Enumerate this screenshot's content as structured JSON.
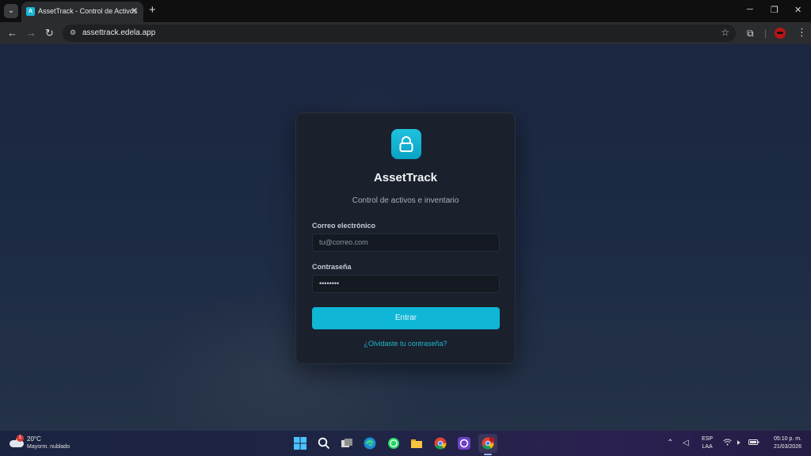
{
  "browser": {
    "tab_title": "AssetTrack - Control de Activos",
    "tab_favicon_letter": "A",
    "url": "assettrack.edela.app"
  },
  "login": {
    "app_name": "AssetTrack",
    "subtitle": "Control de activos e inventario",
    "email_label": "Correo electrónico",
    "email_placeholder": "tu@correo.com",
    "password_label": "Contraseña",
    "password_value": "••••••••",
    "submit_label": "Entrar",
    "forgot_link": "¿Olvidaste tu contraseña?",
    "accent_color": "#0fb6d6"
  },
  "taskbar": {
    "weather_temp": "20°C",
    "weather_condition": "Mayorm. nublado",
    "weather_badge": "1",
    "lang_line1": "ESP",
    "lang_line2": "LAA",
    "time": "05:10 p. m.",
    "date": "21/03/2026",
    "apps": [
      "start-icon",
      "search-icon",
      "task-view-icon",
      "edge-icon",
      "whatsapp-icon",
      "file-explorer-icon",
      "chrome-icon",
      "github-desktop-icon",
      "chrome-profile-icon"
    ]
  }
}
